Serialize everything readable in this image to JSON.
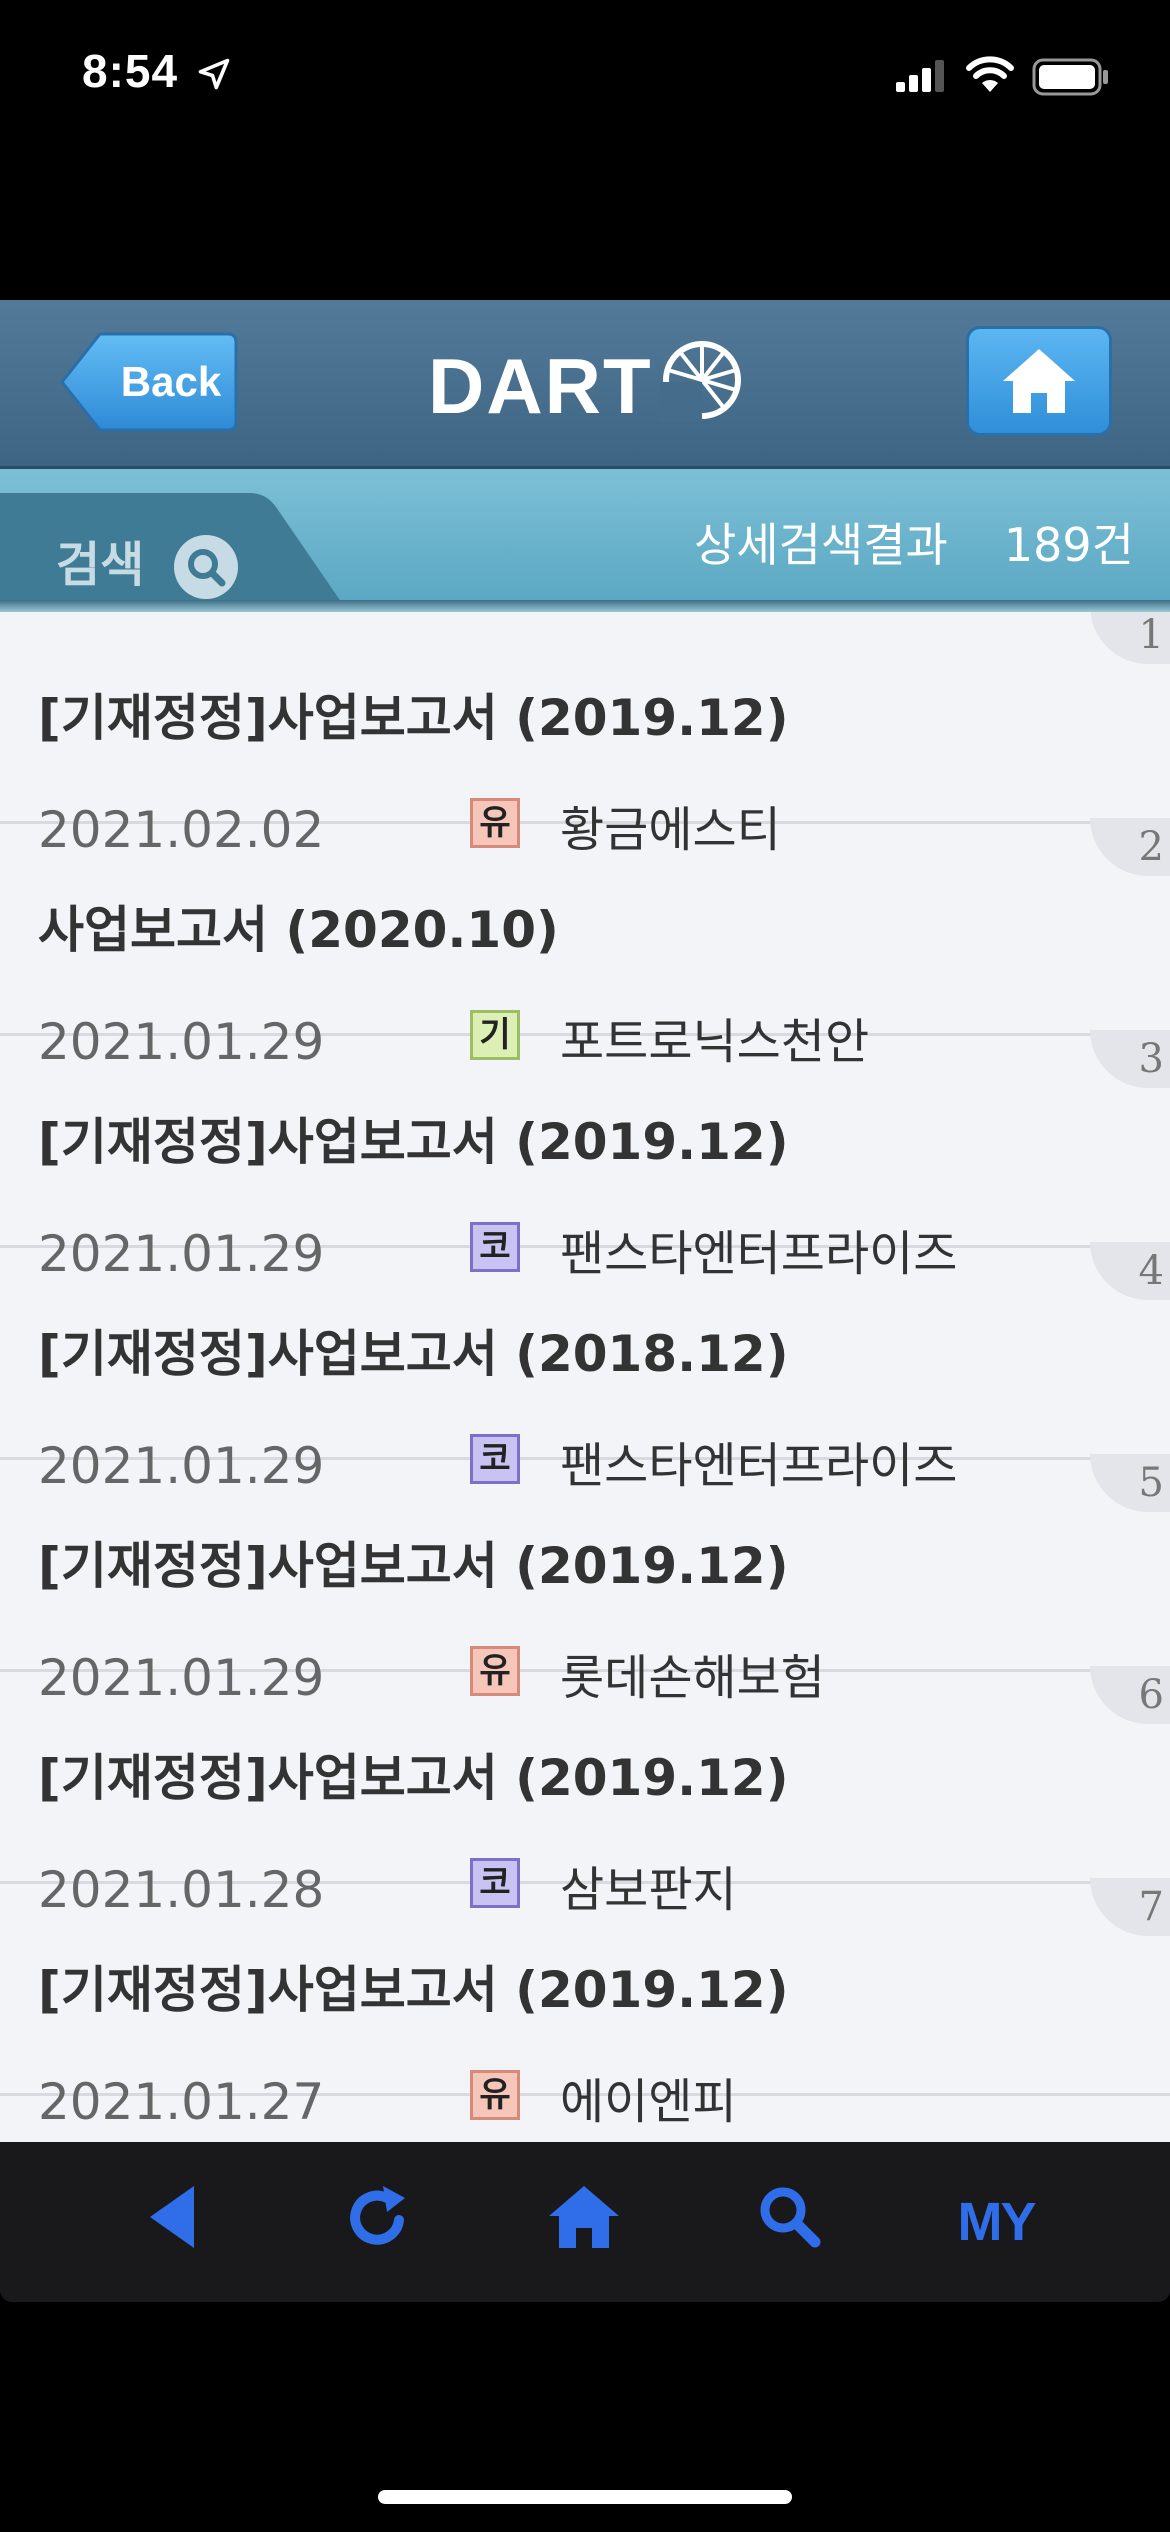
{
  "status_bar": {
    "time": "8:54"
  },
  "header": {
    "back_label": "Back",
    "logo_text": "DART"
  },
  "search_bar": {
    "label": "검색",
    "summary_label": "상세검색결과",
    "count": "189건"
  },
  "results": [
    {
      "number": "1",
      "title": "[기재정정]사업보고서 (2019.12)",
      "date": "2021.02.02",
      "badge": "유",
      "company": "황금에스티"
    },
    {
      "number": "2",
      "title": "사업보고서 (2020.10)",
      "date": "2021.01.29",
      "badge": "기",
      "company": "포트로닉스천안"
    },
    {
      "number": "3",
      "title": "[기재정정]사업보고서 (2019.12)",
      "date": "2021.01.29",
      "badge": "코",
      "company": "팬스타엔터프라이즈"
    },
    {
      "number": "4",
      "title": "[기재정정]사업보고서 (2018.12)",
      "date": "2021.01.29",
      "badge": "코",
      "company": "팬스타엔터프라이즈"
    },
    {
      "number": "5",
      "title": "[기재정정]사업보고서 (2019.12)",
      "date": "2021.01.29",
      "badge": "유",
      "company": "롯데손해보험"
    },
    {
      "number": "6",
      "title": "[기재정정]사업보고서 (2019.12)",
      "date": "2021.01.28",
      "badge": "코",
      "company": "삼보판지"
    },
    {
      "number": "7",
      "title": "[기재정정]사업보고서 (2019.12)",
      "date": "2021.01.27",
      "badge": "유",
      "company": "에이엔피"
    }
  ],
  "toolbar": {
    "my_label": "MY",
    "accent_color": "#2f6ee8"
  },
  "colors": {
    "header_bg": "#3e6584",
    "search_bar_bg": "#5aa6c2",
    "list_bg": "#f3f4f8"
  }
}
